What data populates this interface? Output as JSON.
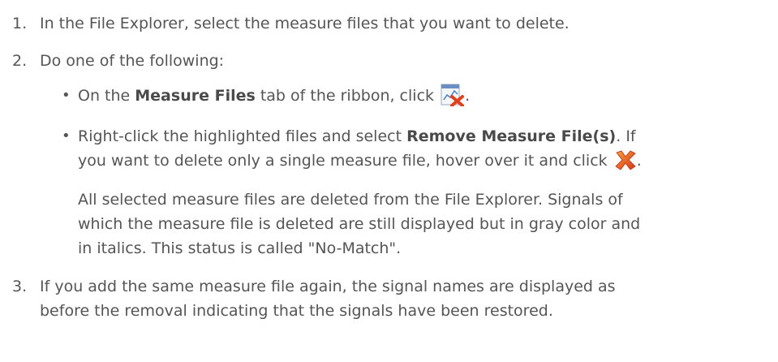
{
  "steps": [
    {
      "number": "1.",
      "text": "In the File Explorer, select the measure files that you want to delete."
    },
    {
      "number": "2.",
      "text": "Do one of the following:",
      "bullets": [
        {
          "pre": "On the ",
          "bold": "Measure Files",
          "post": " tab of the ribbon, click",
          "icon": "remove-measure-file-icon",
          "end": "."
        },
        {
          "pre": "Right-click the highlighted files and select ",
          "bold": "Remove Measure File(s)",
          "post": ". If",
          "line2_pre": "you want to delete only a single measure file, hover over it and click",
          "icon": "red-x-delete-icon",
          "end": "."
        }
      ],
      "result_lines": [
        "All selected measure files are deleted from the File Explorer. Signals of",
        "which the measure file is deleted are still displayed but in gray color and",
        "in italics. This status is called \"No-Match\"."
      ]
    },
    {
      "number": "3.",
      "lines": [
        "If you add the same measure file again, the signal names are displayed as",
        "before the removal indicating that the signals have been restored."
      ]
    }
  ],
  "colors": {
    "text": "#555555",
    "icon_red": "#e0401c",
    "icon_orange": "#f08a24"
  }
}
